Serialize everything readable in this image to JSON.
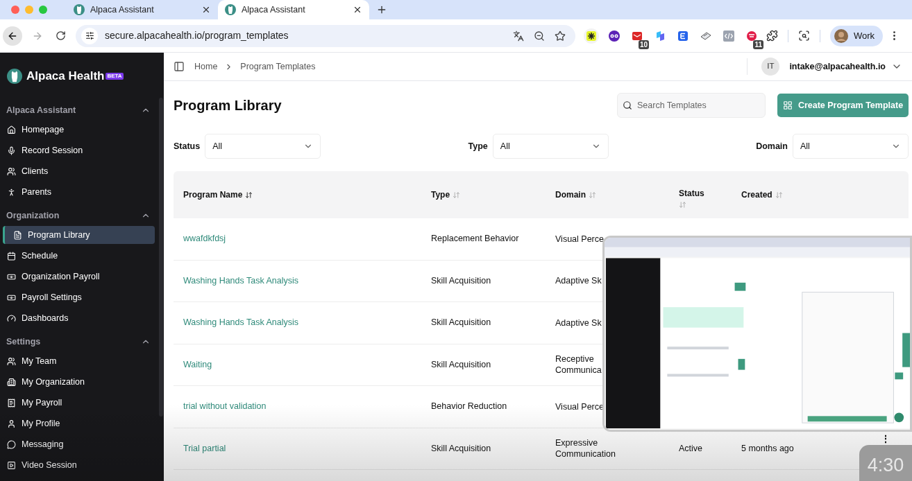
{
  "browser": {
    "tabs": [
      {
        "title": "Alpaca Assistant",
        "selected": false
      },
      {
        "title": "Alpaca Assistant",
        "selected": true
      }
    ],
    "url": "secure.alpacahealth.io/program_templates",
    "extensions": [
      {
        "kind": "spark"
      },
      {
        "kind": "owl"
      },
      {
        "kind": "mail",
        "badge": "10"
      },
      {
        "kind": "wing"
      },
      {
        "kind": "square"
      },
      {
        "kind": "pad"
      },
      {
        "kind": "code"
      },
      {
        "kind": "ring",
        "badge": "11"
      }
    ],
    "profile": "Work"
  },
  "brand": {
    "name": "Alpaca Health",
    "badge": "BETA"
  },
  "sidebar": {
    "sections": [
      {
        "title": "Alpaca Assistant",
        "expanded": true,
        "items": [
          {
            "label": "Homepage",
            "selected": false
          },
          {
            "label": "Record Session",
            "selected": false
          },
          {
            "label": "Clients",
            "selected": false
          },
          {
            "label": "Parents",
            "selected": false
          }
        ]
      },
      {
        "title": "Organization",
        "expanded": true,
        "items": [
          {
            "label": "Program Library",
            "selected": true
          },
          {
            "label": "Schedule",
            "selected": false
          },
          {
            "label": "Organization Payroll",
            "selected": false
          },
          {
            "label": "Payroll Settings",
            "selected": false
          },
          {
            "label": "Dashboards",
            "selected": false
          }
        ]
      },
      {
        "title": "Settings",
        "expanded": true,
        "items": [
          {
            "label": "My Team",
            "selected": false
          },
          {
            "label": "My Organization",
            "selected": false
          },
          {
            "label": "My Payroll",
            "selected": false
          },
          {
            "label": "My Profile",
            "selected": false
          },
          {
            "label": "Messaging",
            "selected": false
          },
          {
            "label": "Video Session",
            "selected": false
          }
        ]
      }
    ]
  },
  "header": {
    "breadcrumb": [
      "Home",
      "Program Templates"
    ],
    "initials": "IT",
    "email": "intake@alpacahealth.io"
  },
  "page": {
    "title": "Program Library",
    "search": {
      "placeholder": "Search Templates"
    },
    "create_button": "Create Program Template"
  },
  "filters": [
    {
      "label": "Status",
      "value": "All"
    },
    {
      "label": "Type",
      "value": "All"
    },
    {
      "label": "Domain",
      "value": "All"
    }
  ],
  "table": {
    "columns": [
      {
        "label": "Program Name",
        "sorted": true
      },
      {
        "label": "Type",
        "sorted": false
      },
      {
        "label": "Domain",
        "sorted": false
      },
      {
        "label": "Status",
        "sorted": false
      },
      {
        "label": "Created",
        "sorted": false
      }
    ],
    "rows": [
      {
        "name": "wwafdkfdsj",
        "type": "Replacement Behavior",
        "domain": "Visual Perce"
      },
      {
        "name": "Washing Hands Task Analysis",
        "type": "Skill Acquisition",
        "domain": "Adaptive Sk"
      },
      {
        "name": "Washing Hands Task Analysis",
        "type": "Skill Acquisition",
        "domain": "Adaptive Sk"
      },
      {
        "name": "Waiting",
        "type": "Skill Acquisition",
        "domain": "Receptive\nCommunica"
      },
      {
        "name": "trial without validation",
        "type": "Behavior Reduction",
        "domain": "Visual Perce"
      },
      {
        "name": "Trial partial",
        "type": "Skill Acquisition",
        "domain": "Expressive\nCommunication",
        "status": "Active",
        "created": "5 months ago",
        "menu": "⋮"
      }
    ]
  },
  "video": {
    "time": "4:30"
  }
}
